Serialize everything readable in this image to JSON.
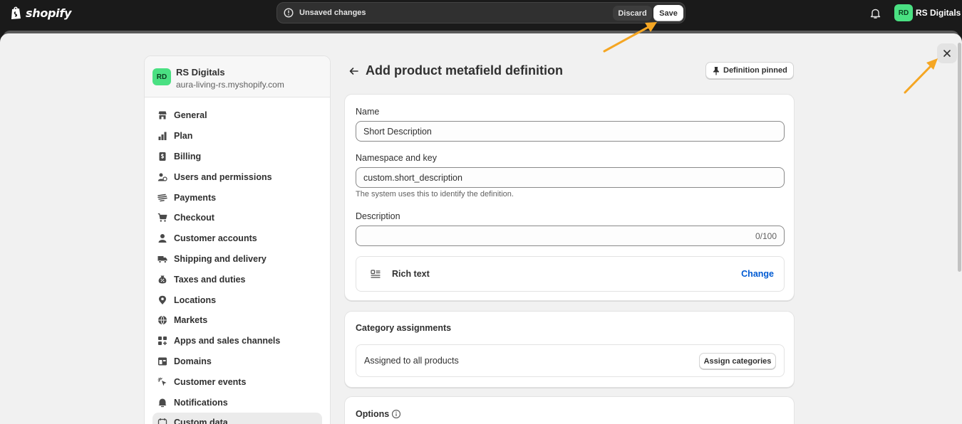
{
  "topbar": {
    "logo_text": "shopify",
    "unsaved_text": "Unsaved changes",
    "discard_label": "Discard",
    "save_label": "Save",
    "avatar_initials": "RD",
    "store_name": "RS Digitals"
  },
  "sidebar": {
    "avatar_initials": "RD",
    "store_name": "RS Digitals",
    "store_domain": "aura-living-rs.myshopify.com",
    "items": [
      {
        "label": "General",
        "icon": "store-icon"
      },
      {
        "label": "Plan",
        "icon": "plan-icon"
      },
      {
        "label": "Billing",
        "icon": "billing-icon"
      },
      {
        "label": "Users and permissions",
        "icon": "users-icon"
      },
      {
        "label": "Payments",
        "icon": "payments-icon"
      },
      {
        "label": "Checkout",
        "icon": "cart-icon"
      },
      {
        "label": "Customer accounts",
        "icon": "person-icon"
      },
      {
        "label": "Shipping and delivery",
        "icon": "truck-icon"
      },
      {
        "label": "Taxes and duties",
        "icon": "tax-icon"
      },
      {
        "label": "Locations",
        "icon": "location-icon"
      },
      {
        "label": "Markets",
        "icon": "globe-icon"
      },
      {
        "label": "Apps and sales channels",
        "icon": "apps-icon"
      },
      {
        "label": "Domains",
        "icon": "domain-icon"
      },
      {
        "label": "Customer events",
        "icon": "cursor-icon"
      },
      {
        "label": "Notifications",
        "icon": "bell-icon"
      },
      {
        "label": "Custom data",
        "icon": "custom-data-icon",
        "active": true
      }
    ]
  },
  "main": {
    "title": "Add product metafield definition",
    "pinned_label": "Definition pinned",
    "name_label": "Name",
    "name_value": "Short Description",
    "namespace_label": "Namespace and key",
    "namespace_value": "custom.short_description",
    "namespace_help": "The system uses this to identify the definition.",
    "description_label": "Description",
    "description_value": "",
    "description_counter": "0/100",
    "type_label": "Rich text",
    "change_label": "Change",
    "category_title": "Category assignments",
    "category_text": "Assigned to all products",
    "assign_button": "Assign categories",
    "options_title": "Options"
  },
  "colors": {
    "accent_link": "#005bd3",
    "avatar_bg": "#4ae082",
    "annotation_arrow": "#f5a623"
  }
}
